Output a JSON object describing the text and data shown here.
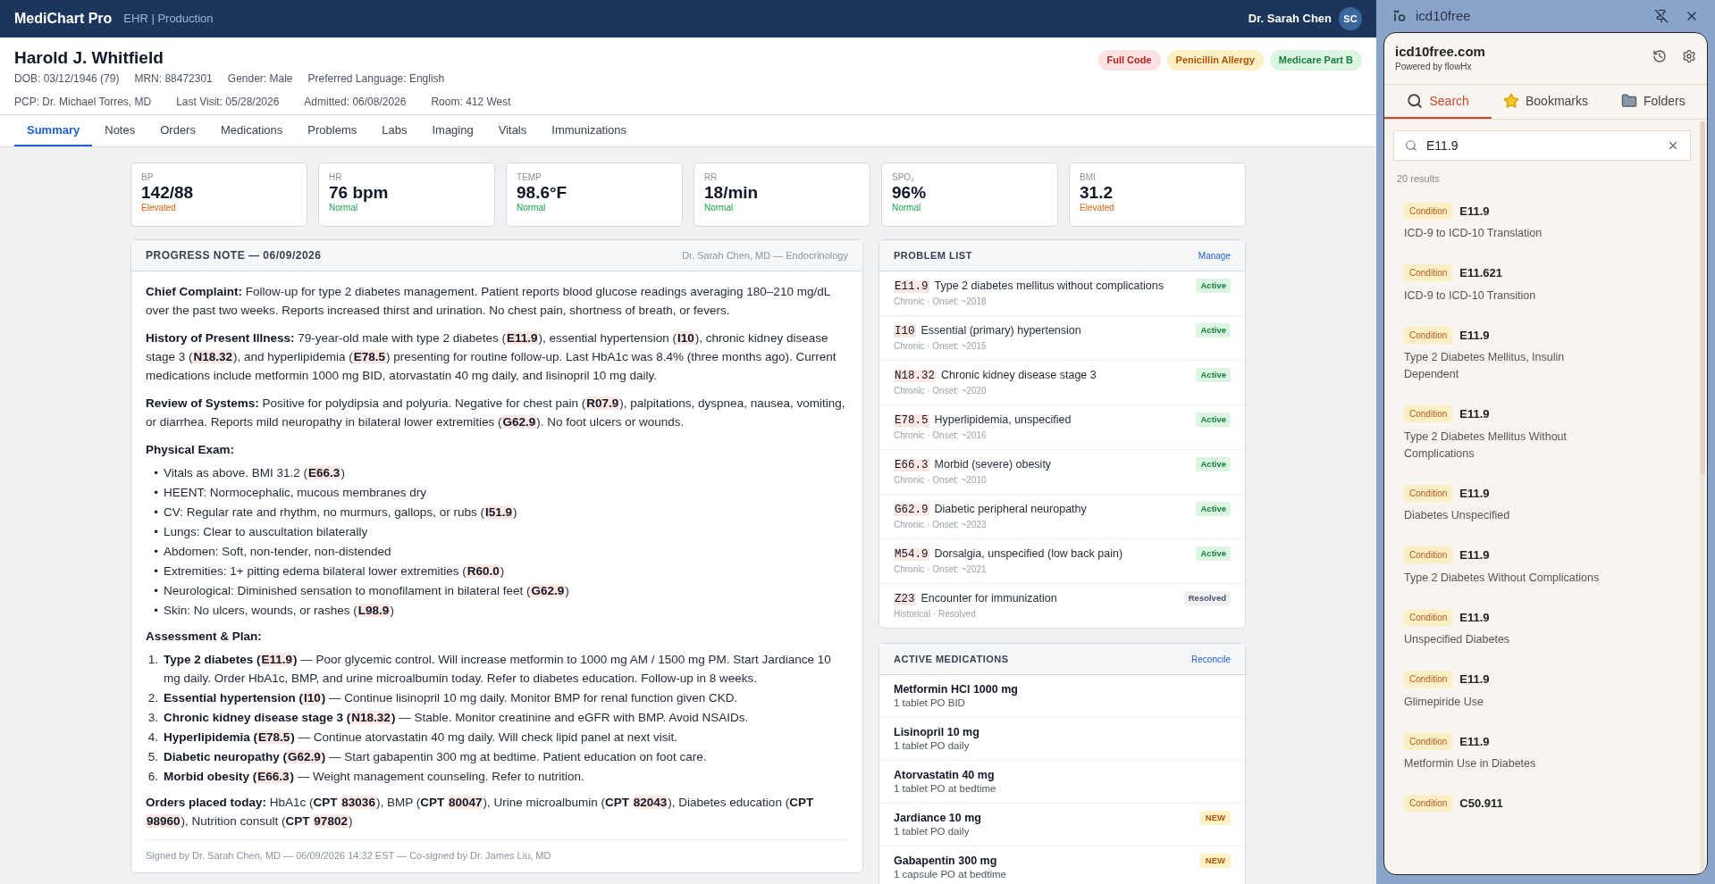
{
  "app": {
    "title": "MediChart Pro",
    "environment": "EHR | Production",
    "user": "Dr. Sarah Chen",
    "user_initials": "SC"
  },
  "patient": {
    "name": "Harold J. Whitfield",
    "meta_line_1": [
      "DOB: 03/12/1946 (79)",
      "MRN: 88472301",
      "Gender: Male",
      "Preferred Language: English"
    ],
    "meta_line_2": [
      "PCP: Dr. Michael Torres, MD",
      "Last Visit: 05/28/2026",
      "Admitted: 06/08/2026",
      "Room: 412 West"
    ],
    "flags": [
      {
        "label": "Full Code",
        "kind": "danger"
      },
      {
        "label": "Penicillin Allergy",
        "kind": "warning"
      },
      {
        "label": "Medicare Part B",
        "kind": "success"
      }
    ]
  },
  "tabs": [
    {
      "label": "Summary",
      "selected": true
    },
    {
      "label": "Notes",
      "selected": false
    },
    {
      "label": "Orders",
      "selected": false
    },
    {
      "label": "Medications",
      "selected": false
    },
    {
      "label": "Problems",
      "selected": false
    },
    {
      "label": "Labs",
      "selected": false
    },
    {
      "label": "Imaging",
      "selected": false
    },
    {
      "label": "Vitals",
      "selected": false
    },
    {
      "label": "Immunizations",
      "selected": false
    }
  ],
  "vitals": [
    {
      "label": "BP",
      "value": "142/88",
      "status": "Elevated",
      "elevated": true
    },
    {
      "label": "HR",
      "value": "76 bpm",
      "status": "Normal",
      "elevated": false
    },
    {
      "label": "TEMP",
      "value": "98.6°F",
      "status": "Normal",
      "elevated": false
    },
    {
      "label": "RR",
      "value": "18/min",
      "status": "Normal",
      "elevated": false
    },
    {
      "label": "SPO₂",
      "value": "96%",
      "status": "Normal",
      "elevated": false
    },
    {
      "label": "BMI",
      "value": "31.2",
      "status": "Elevated",
      "elevated": true
    }
  ],
  "progress_note": {
    "title": "PROGRESS NOTE — 06/09/2026",
    "author": "Dr. Sarah Chen, MD — Endocrinology",
    "blocks": [
      {
        "kind": "para",
        "parts": [
          {
            "kind": "bold",
            "text": "Chief Complaint:"
          },
          {
            "kind": "plain",
            "text": " Follow-up for type 2 diabetes management. Patient reports blood glucose readings averaging 180–210 mg/dL over the past two weeks. Reports increased thirst and urination. No chest pain, shortness of breath, or fevers."
          }
        ]
      },
      {
        "kind": "para",
        "parts": [
          {
            "kind": "bold",
            "text": "History of Present Illness:"
          },
          {
            "kind": "plain",
            "text": " 79-year-old male with type 2 diabetes ("
          },
          {
            "kind": "code",
            "text": "E11.9"
          },
          {
            "kind": "plain",
            "text": "), essential hypertension ("
          },
          {
            "kind": "code",
            "text": "I10"
          },
          {
            "kind": "plain",
            "text": "), chronic kidney disease stage 3 ("
          },
          {
            "kind": "code",
            "text": "N18.32"
          },
          {
            "kind": "plain",
            "text": "), and hyperlipidemia ("
          },
          {
            "kind": "code",
            "text": "E78.5"
          },
          {
            "kind": "plain",
            "text": ") presenting for routine follow-up. Last HbA1c was 8.4% (three months ago). Current medications include metformin 1000 mg BID, atorvastatin 40 mg daily, and lisinopril 10 mg daily."
          }
        ]
      },
      {
        "kind": "para",
        "parts": [
          {
            "kind": "bold",
            "text": "Review of Systems:"
          },
          {
            "kind": "plain",
            "text": " Positive for polydipsia and polyuria. Negative for chest pain ("
          },
          {
            "kind": "code",
            "text": "R07.9"
          },
          {
            "kind": "plain",
            "text": "), palpitations, dyspnea, nausea, vomiting, or diarrhea. Reports mild neuropathy in bilateral lower extremities ("
          },
          {
            "kind": "code",
            "text": "G62.9"
          },
          {
            "kind": "plain",
            "text": "). No foot ulcers or wounds."
          }
        ]
      },
      {
        "kind": "heading",
        "text": "Physical Exam:"
      },
      {
        "kind": "list",
        "items": [
          {
            "marker": "•",
            "parts": [
              {
                "kind": "plain",
                "text": "Vitals as above. BMI 31.2 ("
              },
              {
                "kind": "code",
                "text": "E66.3"
              },
              {
                "kind": "plain",
                "text": ")"
              }
            ]
          },
          {
            "marker": "•",
            "parts": [
              {
                "kind": "plain",
                "text": "HEENT: Normocephalic, mucous membranes dry"
              }
            ]
          },
          {
            "marker": "•",
            "parts": [
              {
                "kind": "plain",
                "text": "CV: Regular rate and rhythm, no murmurs, gallops, or rubs ("
              },
              {
                "kind": "code",
                "text": "I51.9"
              },
              {
                "kind": "plain",
                "text": ")"
              }
            ]
          },
          {
            "marker": "•",
            "parts": [
              {
                "kind": "plain",
                "text": "Lungs: Clear to auscultation bilaterally"
              }
            ]
          },
          {
            "marker": "•",
            "parts": [
              {
                "kind": "plain",
                "text": "Abdomen: Soft, non-tender, non-distended"
              }
            ]
          },
          {
            "marker": "•",
            "parts": [
              {
                "kind": "plain",
                "text": "Extremities: 1+ pitting edema bilateral lower extremities ("
              },
              {
                "kind": "code",
                "text": "R60.0"
              },
              {
                "kind": "plain",
                "text": ")"
              }
            ]
          },
          {
            "marker": "•",
            "parts": [
              {
                "kind": "plain",
                "text": "Neurological: Diminished sensation to monofilament in bilateral feet ("
              },
              {
                "kind": "code",
                "text": "G62.9"
              },
              {
                "kind": "plain",
                "text": ")"
              }
            ]
          },
          {
            "marker": "•",
            "parts": [
              {
                "kind": "plain",
                "text": "Skin: No ulcers, wounds, or rashes ("
              },
              {
                "kind": "code",
                "text": "L98.9"
              },
              {
                "kind": "plain",
                "text": ")"
              }
            ]
          }
        ]
      },
      {
        "kind": "heading",
        "text": "Assessment & Plan:"
      },
      {
        "kind": "list",
        "items": [
          {
            "marker": "1.",
            "parts": [
              {
                "kind": "bold",
                "text": "Type 2 diabetes ("
              },
              {
                "kind": "code",
                "text": "E11.9"
              },
              {
                "kind": "bold",
                "text": ")"
              },
              {
                "kind": "plain",
                "text": " — Poor glycemic control. Will increase metformin to 1000 mg AM / 1500 mg PM. Start Jardiance 10 mg daily. Order HbA1c, BMP, and urine microalbumin today. Refer to diabetes education. Follow-up in 8 weeks."
              }
            ]
          },
          {
            "marker": "2.",
            "parts": [
              {
                "kind": "bold",
                "text": "Essential hypertension ("
              },
              {
                "kind": "code",
                "text": "I10"
              },
              {
                "kind": "bold",
                "text": ")"
              },
              {
                "kind": "plain",
                "text": " — Continue lisinopril 10 mg daily. Monitor BMP for renal function given CKD."
              }
            ]
          },
          {
            "marker": "3.",
            "parts": [
              {
                "kind": "bold",
                "text": "Chronic kidney disease stage 3 ("
              },
              {
                "kind": "code",
                "text": "N18.32"
              },
              {
                "kind": "bold",
                "text": ")"
              },
              {
                "kind": "plain",
                "text": " — Stable. Monitor creatinine and eGFR with BMP. Avoid NSAIDs."
              }
            ]
          },
          {
            "marker": "4.",
            "parts": [
              {
                "kind": "bold",
                "text": "Hyperlipidemia ("
              },
              {
                "kind": "code",
                "text": "E78.5"
              },
              {
                "kind": "bold",
                "text": ")"
              },
              {
                "kind": "plain",
                "text": " — Continue atorvastatin 40 mg daily. Will check lipid panel at next visit."
              }
            ]
          },
          {
            "marker": "5.",
            "parts": [
              {
                "kind": "bold",
                "text": "Diabetic neuropathy ("
              },
              {
                "kind": "code",
                "text": "G62.9"
              },
              {
                "kind": "bold",
                "text": ")"
              },
              {
                "kind": "plain",
                "text": " — Start gabapentin 300 mg at bedtime. Patient education on foot care."
              }
            ]
          },
          {
            "marker": "6.",
            "parts": [
              {
                "kind": "bold",
                "text": "Morbid obesity ("
              },
              {
                "kind": "code",
                "text": "E66.3"
              },
              {
                "kind": "bold",
                "text": ")"
              },
              {
                "kind": "plain",
                "text": " — Weight management counseling. Refer to nutrition."
              }
            ]
          }
        ]
      },
      {
        "kind": "para",
        "parts": [
          {
            "kind": "bold",
            "text": "Orders placed today:"
          },
          {
            "kind": "plain",
            "text": " HbA1c ("
          },
          {
            "kind": "bold",
            "text": "CPT "
          },
          {
            "kind": "code",
            "text": "83036"
          },
          {
            "kind": "plain",
            "text": "), BMP ("
          },
          {
            "kind": "bold",
            "text": "CPT "
          },
          {
            "kind": "code",
            "text": "80047"
          },
          {
            "kind": "plain",
            "text": "), Urine microalbumin ("
          },
          {
            "kind": "bold",
            "text": "CPT "
          },
          {
            "kind": "code",
            "text": "82043"
          },
          {
            "kind": "plain",
            "text": "), Diabetes education ("
          },
          {
            "kind": "bold",
            "text": "CPT "
          },
          {
            "kind": "code",
            "text": "98960"
          },
          {
            "kind": "plain",
            "text": "), Nutrition consult ("
          },
          {
            "kind": "bold",
            "text": "CPT "
          },
          {
            "kind": "code",
            "text": "97802"
          },
          {
            "kind": "plain",
            "text": ")"
          }
        ]
      }
    ],
    "signature": "Signed by Dr. Sarah Chen, MD — 06/09/2026 14:32 EST — Co-signed by Dr. James Liu, MD"
  },
  "problem_list": {
    "title": "PROBLEM LIST",
    "action": "Manage",
    "items": [
      {
        "code": "E11.9",
        "title": "Type 2 diabetes mellitus without complications",
        "detail": "Chronic · Onset: ~2018",
        "status": "Active",
        "resolved": false
      },
      {
        "code": "I10",
        "title": "Essential (primary) hypertension",
        "detail": "Chronic · Onset: ~2015",
        "status": "Active",
        "resolved": false
      },
      {
        "code": "N18.32",
        "title": "Chronic kidney disease stage 3",
        "detail": "Chronic · Onset: ~2020",
        "status": "Active",
        "resolved": false
      },
      {
        "code": "E78.5",
        "title": "Hyperlipidemia, unspecified",
        "detail": "Chronic · Onset: ~2016",
        "status": "Active",
        "resolved": false
      },
      {
        "code": "E66.3",
        "title": "Morbid (severe) obesity",
        "detail": "Chronic · Onset: ~2010",
        "status": "Active",
        "resolved": false
      },
      {
        "code": "G62.9",
        "title": "Diabetic peripheral neuropathy",
        "detail": "Chronic · Onset: ~2023",
        "status": "Active",
        "resolved": false
      },
      {
        "code": "M54.9",
        "title": "Dorsalgia, unspecified (low back pain)",
        "detail": "Chronic · Onset: ~2021",
        "status": "Active",
        "resolved": false
      },
      {
        "code": "Z23",
        "title": "Encounter for immunization",
        "detail": "Historical · Resolved",
        "status": "Resolved",
        "resolved": true
      }
    ]
  },
  "medications": {
    "title": "ACTIVE MEDICATIONS",
    "action": "Reconcile",
    "items": [
      {
        "name": "Metformin HCl 1000 mg",
        "sig": "1 tablet PO BID"
      },
      {
        "name": "Lisinopril 10 mg",
        "sig": "1 tablet PO daily"
      },
      {
        "name": "Atorvastatin 40 mg",
        "sig": "1 tablet PO at bedtime"
      },
      {
        "name": "Jardiance 10 mg",
        "sig": "1 tablet PO daily",
        "badge": "NEW"
      },
      {
        "name": "Gabapentin 300 mg",
        "sig": "1 capsule PO at bedtime",
        "badge": "NEW"
      }
    ]
  },
  "side_panel": {
    "window_title": "icd10free",
    "site": "icd10free.com",
    "powered_by": "Powered by flowHx",
    "tabs": [
      {
        "label": "Search",
        "kind": "search",
        "selected": true
      },
      {
        "label": "Bookmarks",
        "kind": "bookmarks",
        "selected": false
      },
      {
        "label": "Folders",
        "kind": "folders",
        "selected": false
      }
    ],
    "search": {
      "value": "E11.9"
    },
    "result_count": "20 results",
    "results": [
      {
        "type": "Condition",
        "code": "E11.9",
        "description": "ICD-9 to ICD-10 Translation"
      },
      {
        "type": "Condition",
        "code": "E11.621",
        "description": "ICD-9 to ICD-10 Transition"
      },
      {
        "type": "Condition",
        "code": "E11.9",
        "description": "Type 2 Diabetes Mellitus, Insulin Dependent"
      },
      {
        "type": "Condition",
        "code": "E11.9",
        "description": "Type 2 Diabetes Mellitus Without Complications"
      },
      {
        "type": "Condition",
        "code": "E11.9",
        "description": "Diabetes Unspecified"
      },
      {
        "type": "Condition",
        "code": "E11.9",
        "description": "Type 2 Diabetes Without Complications"
      },
      {
        "type": "Condition",
        "code": "E11.9",
        "description": "Unspecified Diabetes"
      },
      {
        "type": "Condition",
        "code": "E11.9",
        "description": "Glimepiride Use"
      },
      {
        "type": "Condition",
        "code": "E11.9",
        "description": "Metformin Use in Diabetes"
      },
      {
        "type": "Condition",
        "code": "C50.911"
      }
    ]
  }
}
